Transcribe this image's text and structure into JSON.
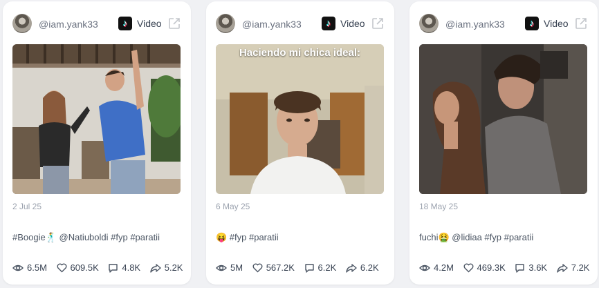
{
  "cards": [
    {
      "handle": "@iam.yank33",
      "type_label": "Video",
      "date": "2 Jul 25",
      "caption": "#Boogie🕺 @Natiuboldi #fyp #paratii",
      "stats": {
        "views": "6.5M",
        "likes": "609.5K",
        "comments": "4.8K",
        "shares": "5.2K"
      }
    },
    {
      "handle": "@iam.yank33",
      "type_label": "Video",
      "overlay_text": "Haciendo mi chica ideal:",
      "date": "6 May 25",
      "caption": "😝 #fyp #paratii",
      "stats": {
        "views": "5M",
        "likes": "567.2K",
        "comments": "6.2K",
        "shares": "6.2K"
      }
    },
    {
      "handle": "@iam.yank33",
      "type_label": "Video",
      "date": "18 May 25",
      "caption": "fuchi🤮 @lidiaa #fyp #paratii",
      "stats": {
        "views": "4.2M",
        "likes": "469.3K",
        "comments": "3.6K",
        "shares": "7.2K"
      }
    }
  ],
  "icons": {
    "platform": "tiktok-icon",
    "external": "external-link-icon",
    "views": "eye-icon",
    "likes": "heart-icon",
    "comments": "comment-icon",
    "shares": "share-icon"
  }
}
